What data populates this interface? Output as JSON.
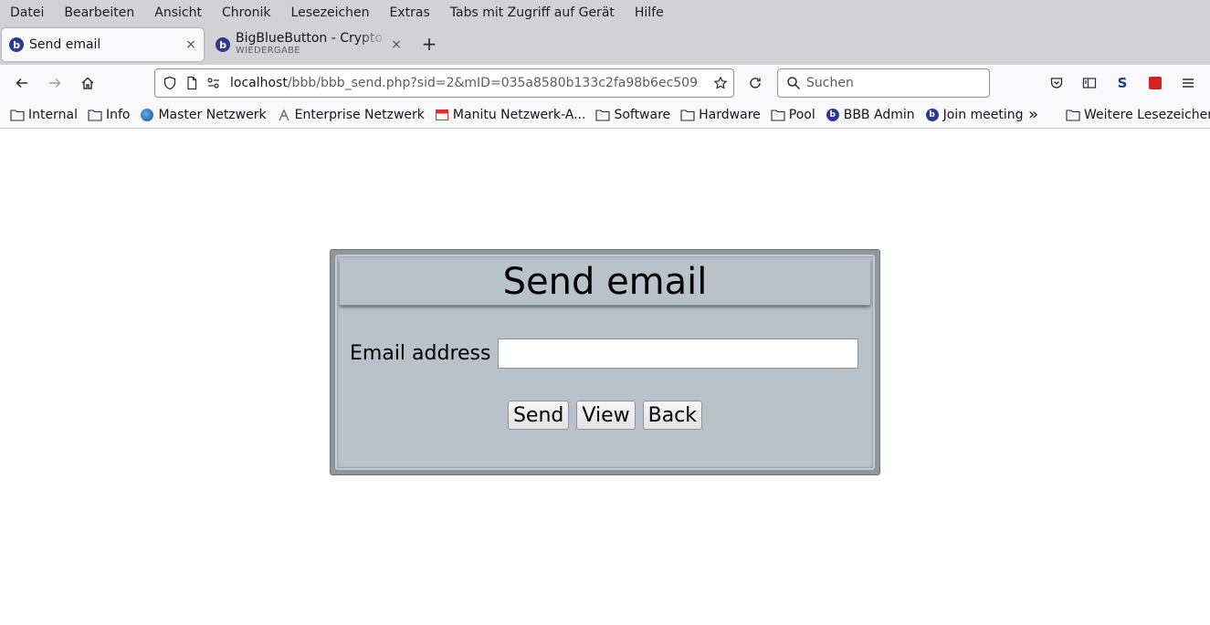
{
  "menubar": {
    "items": [
      "Datei",
      "Bearbeiten",
      "Ansicht",
      "Chronik",
      "Lesezeichen",
      "Extras",
      "Tabs mit Zugriff auf Gerät",
      "Hilfe"
    ]
  },
  "tabs": {
    "active": {
      "title": "Send email",
      "close": "×"
    },
    "second": {
      "title": "BigBlueButton - Crypto-B",
      "subtitle": "WIEDERGABE",
      "close": "×"
    },
    "new_tab": "+"
  },
  "navbar": {
    "url_host": "localhost",
    "url_path": "/bbb/bbb_send.php?sid=2&mID=035a8580b133c2fa98b6ec509",
    "search_placeholder": "Suchen"
  },
  "bookmarks": {
    "items": [
      {
        "label": "Internal",
        "icon": "folder-icon"
      },
      {
        "label": "Info",
        "icon": "folder-icon"
      },
      {
        "label": "Master Netzwerk",
        "icon": "globe-icon"
      },
      {
        "label": "Enterprise Netzwerk",
        "icon": "enterprise-icon"
      },
      {
        "label": "Manitu Netzwerk-A...",
        "icon": "manitu-icon"
      },
      {
        "label": "Software",
        "icon": "folder-icon"
      },
      {
        "label": "Hardware",
        "icon": "folder-icon"
      },
      {
        "label": "Pool",
        "icon": "folder-icon"
      },
      {
        "label": "BBB Admin",
        "icon": "bbb-icon"
      },
      {
        "label": "Join meeting",
        "icon": "bbb-icon"
      }
    ],
    "overflow": "»",
    "further": "Weitere Lesezeichen"
  },
  "page": {
    "title": "Send email",
    "email_label": "Email address",
    "email_value": "",
    "buttons": {
      "send": "Send",
      "view": "View",
      "back": "Back"
    }
  },
  "colors": {
    "panel_bg": "#b9c1c9",
    "panel_border": "#8f969c",
    "chrome_bg": "#d2d2d6",
    "toolbar_bg": "#f9f9fb"
  }
}
